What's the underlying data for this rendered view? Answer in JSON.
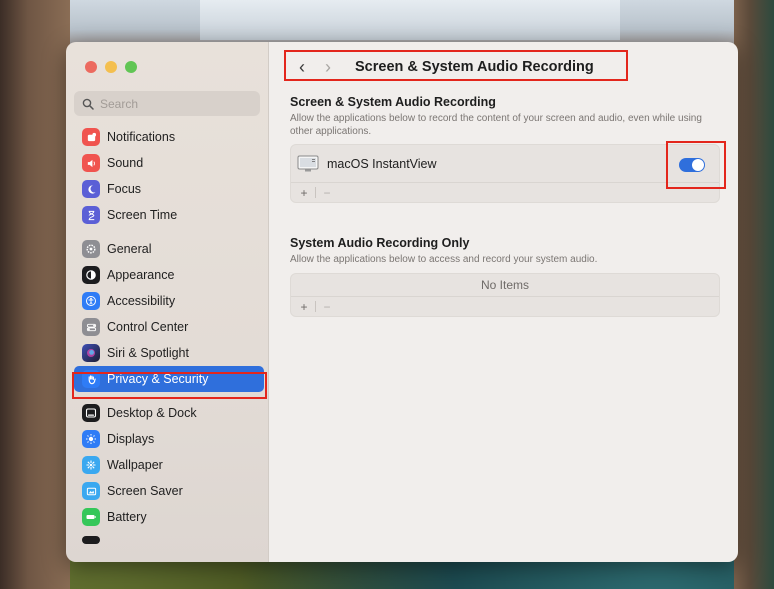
{
  "sidebar": {
    "search_placeholder": "Search",
    "items": [
      {
        "label": "Notifications",
        "icon": "notifications-icon",
        "color": "#f0544f"
      },
      {
        "label": "Sound",
        "icon": "speaker-icon",
        "color": "#f0544f"
      },
      {
        "label": "Focus",
        "icon": "moon-icon",
        "color": "#5b5fd6"
      },
      {
        "label": "Screen Time",
        "icon": "hourglass-icon",
        "color": "#5b5fd6"
      },
      {
        "label": "General",
        "icon": "gear-icon",
        "color": "#8e8e93"
      },
      {
        "label": "Appearance",
        "icon": "appearance-icon",
        "color": "#1c1c1e"
      },
      {
        "label": "Accessibility",
        "icon": "accessibility-icon",
        "color": "#2f7cf6"
      },
      {
        "label": "Control Center",
        "icon": "control-center-icon",
        "color": "#8e8e93"
      },
      {
        "label": "Siri & Spotlight",
        "icon": "siri-icon",
        "color": "#3a3a6a"
      },
      {
        "label": "Privacy & Security",
        "icon": "hand-icon",
        "color": "#2f7cf6",
        "selected": true
      },
      {
        "label": "Desktop & Dock",
        "icon": "dock-icon",
        "color": "#1c1c1e"
      },
      {
        "label": "Displays",
        "icon": "sun-icon",
        "color": "#2f7cf6"
      },
      {
        "label": "Wallpaper",
        "icon": "wallpaper-icon",
        "color": "#3aa8f0"
      },
      {
        "label": "Screen Saver",
        "icon": "screen-saver-icon",
        "color": "#3aa8f0"
      },
      {
        "label": "Battery",
        "icon": "battery-icon",
        "color": "#34c759"
      }
    ]
  },
  "titlebar": {
    "back": "‹",
    "forward": "›",
    "title": "Screen & System Audio Recording"
  },
  "screen_recording": {
    "title": "Screen & System Audio Recording",
    "description": "Allow the applications below to record the content of your screen and audio, even while using other applications.",
    "apps": [
      {
        "name": "macOS InstantView",
        "enabled": true
      }
    ],
    "add": "+",
    "remove": "−"
  },
  "audio_only": {
    "title": "System Audio Recording Only",
    "description": "Allow the applications below to access and record your system audio.",
    "empty_text": "No Items",
    "add": "+",
    "remove": "−"
  },
  "colors": {
    "accent": "#2f6fdc",
    "highlight": "#e3261c"
  }
}
